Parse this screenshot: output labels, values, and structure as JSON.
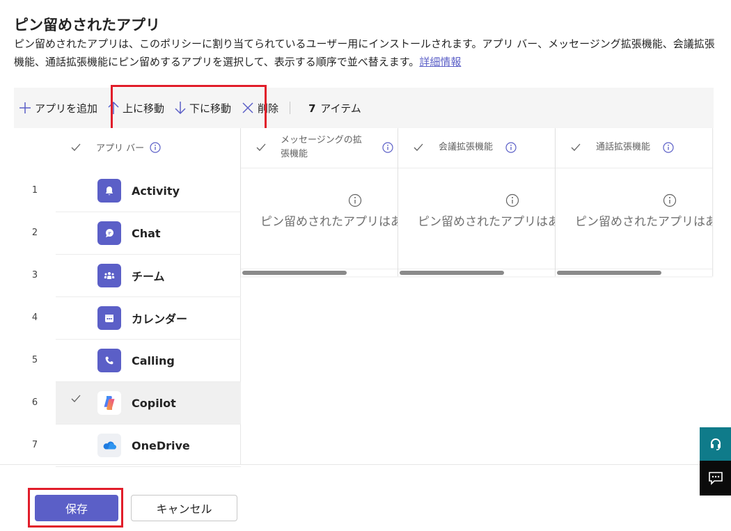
{
  "page": {
    "title": "ピン留めされたアプリ",
    "description": "ピン留めされたアプリは、このポリシーに割り当てられているユーザー用にインストールされます。アプリ バー、メッセージング拡張機能、会議拡張機能、通話拡張機能にピン留めするアプリを選択して、表示する順序で並べ替えます。",
    "learn_more": "詳細情報"
  },
  "toolbar": {
    "add": "アプリを追加",
    "move_up": "上に移動",
    "move_down": "下に移動",
    "delete": "削除",
    "count_num": "7",
    "count_label": "アイテム"
  },
  "columns": {
    "app_bar": "アプリ バー",
    "messaging_line1": "メッセージングの拡",
    "messaging_line2": "張機能",
    "meeting": "会議拡張機能",
    "calling": "通話拡張機能"
  },
  "apps": [
    {
      "num": "1",
      "name": "Activity"
    },
    {
      "num": "2",
      "name": "Chat"
    },
    {
      "num": "3",
      "name": "チーム"
    },
    {
      "num": "4",
      "name": "カレンダー"
    },
    {
      "num": "5",
      "name": "Calling"
    },
    {
      "num": "6",
      "name": "Copilot"
    },
    {
      "num": "7",
      "name": "OneDrive"
    }
  ],
  "empty_message": "ピン留めされたアプリはあ",
  "footer": {
    "save": "保存",
    "cancel": "キャンセル"
  },
  "colors": {
    "accent": "#5b5fc7",
    "highlight": "#e11d2a",
    "help_bg": "#0f7b8a"
  }
}
